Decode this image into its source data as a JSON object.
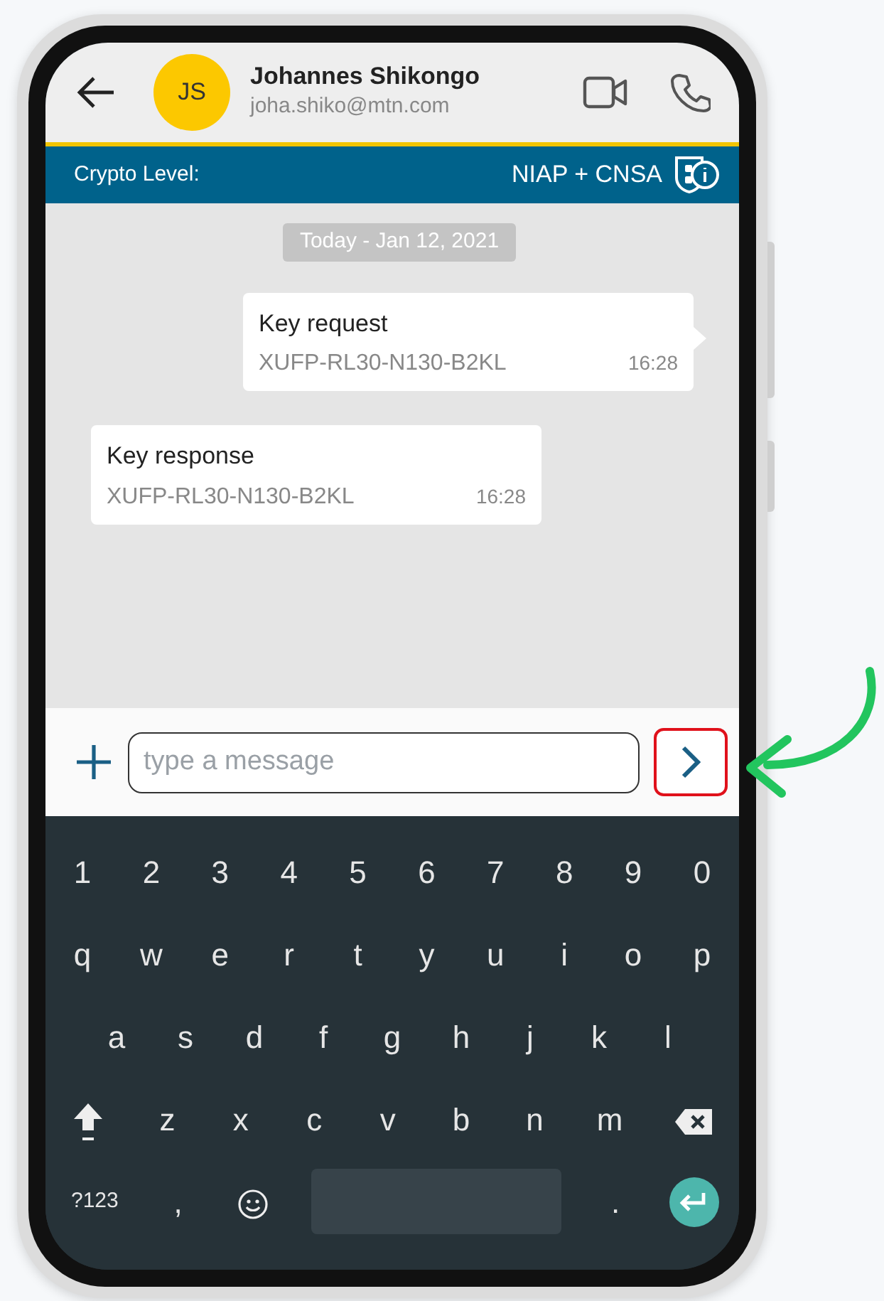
{
  "header": {
    "avatar_initials": "JS",
    "name": "Johannes Shikongo",
    "email": "joha.shiko@mtn.com"
  },
  "crypto_bar": {
    "label": "Crypto Level:",
    "value": "NIAP + CNSA"
  },
  "date_chip": "Today - Jan 12, 2021",
  "messages": [
    {
      "kind": "outgoing",
      "title": "Key request",
      "code": "XUFP-RL30-N130-B2KL",
      "time": "16:28"
    },
    {
      "kind": "incoming",
      "title": "Key response",
      "code": "XUFP-RL30-N130-B2KL",
      "time": "16:28"
    }
  ],
  "composer": {
    "placeholder": "type a message",
    "send_highlighted": true
  },
  "keyboard": {
    "rows": [
      [
        {
          "kind": "char",
          "label": "1"
        },
        {
          "kind": "char",
          "label": "2"
        },
        {
          "kind": "char",
          "label": "3"
        },
        {
          "kind": "char",
          "label": "4"
        },
        {
          "kind": "char",
          "label": "5"
        },
        {
          "kind": "char",
          "label": "6"
        },
        {
          "kind": "char",
          "label": "7"
        },
        {
          "kind": "char",
          "label": "8"
        },
        {
          "kind": "char",
          "label": "9"
        },
        {
          "kind": "char",
          "label": "0"
        }
      ],
      [
        {
          "kind": "char",
          "label": "q"
        },
        {
          "kind": "char",
          "label": "w"
        },
        {
          "kind": "char",
          "label": "e"
        },
        {
          "kind": "char",
          "label": "r"
        },
        {
          "kind": "char",
          "label": "t"
        },
        {
          "kind": "char",
          "label": "y"
        },
        {
          "kind": "char",
          "label": "u"
        },
        {
          "kind": "char",
          "label": "i"
        },
        {
          "kind": "char",
          "label": "o"
        },
        {
          "kind": "char",
          "label": "p"
        }
      ],
      [
        {
          "kind": "char",
          "label": "a"
        },
        {
          "kind": "char",
          "label": "s"
        },
        {
          "kind": "char",
          "label": "d"
        },
        {
          "kind": "char",
          "label": "f"
        },
        {
          "kind": "char",
          "label": "g"
        },
        {
          "kind": "char",
          "label": "h"
        },
        {
          "kind": "char",
          "label": "j"
        },
        {
          "kind": "char",
          "label": "k"
        },
        {
          "kind": "char",
          "label": "l"
        }
      ],
      [
        {
          "kind": "shift"
        },
        {
          "kind": "char",
          "label": "z"
        },
        {
          "kind": "char",
          "label": "x"
        },
        {
          "kind": "char",
          "label": "c"
        },
        {
          "kind": "char",
          "label": "v"
        },
        {
          "kind": "char",
          "label": "b"
        },
        {
          "kind": "char",
          "label": "n"
        },
        {
          "kind": "char",
          "label": "m"
        },
        {
          "kind": "backspace"
        }
      ],
      [
        {
          "kind": "char",
          "label": "?123"
        },
        {
          "kind": "char",
          "label": ","
        },
        {
          "kind": "emoji"
        },
        {
          "kind": "space"
        },
        {
          "kind": "char",
          "label": "."
        },
        {
          "kind": "enter"
        }
      ]
    ]
  }
}
